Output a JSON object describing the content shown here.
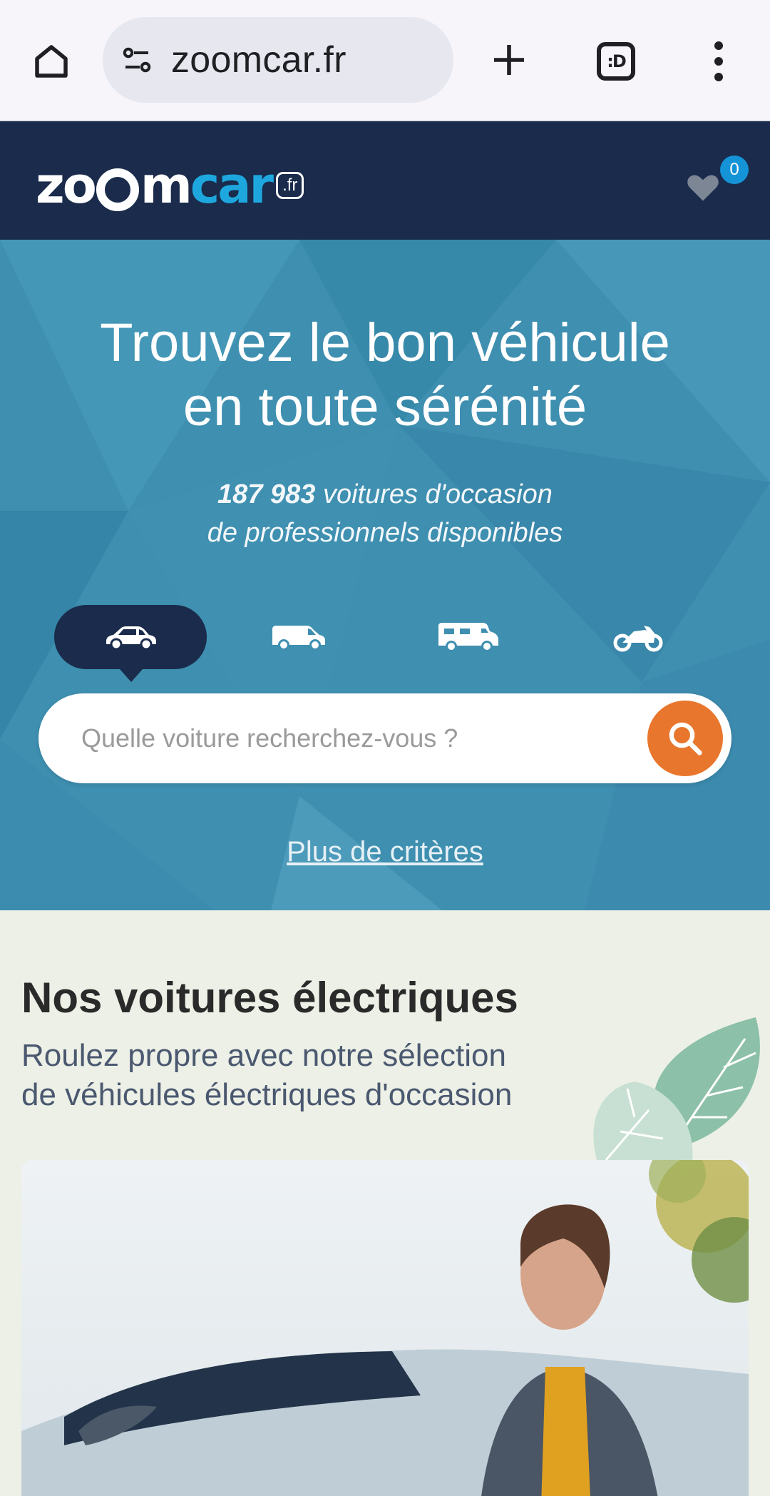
{
  "browser": {
    "url": "zoomcar.fr",
    "tab_icon_text": ":D"
  },
  "header": {
    "logo_text_zo": "zo",
    "logo_text_m": "m",
    "logo_text_car": "car",
    "logo_tld": ".fr",
    "favorites_count": "0"
  },
  "hero": {
    "title_line1": "Trouvez le bon véhicule",
    "title_line2": "en toute sérénité",
    "count": "187 983",
    "sub_line1_rest": " voitures d'occasion",
    "sub_line2": "de professionnels disponibles",
    "vehicle_tabs": [
      {
        "icon": "car-icon",
        "active": true
      },
      {
        "icon": "van-icon",
        "active": false
      },
      {
        "icon": "motorhome-icon",
        "active": false
      },
      {
        "icon": "motorcycle-icon",
        "active": false
      }
    ],
    "search_placeholder": "Quelle voiture recherchez-vous ?",
    "more_criteria": "Plus de critères"
  },
  "electric": {
    "title": "Nos voitures électriques",
    "sub_line1": "Roulez propre avec notre sélection",
    "sub_line2": "de véhicules électriques d'occasion"
  },
  "colors": {
    "header_bg": "#1a2b4b",
    "hero_bg": "#3e8fb0",
    "accent_orange": "#e8762c",
    "logo_blue": "#1ea7df",
    "badge_blue": "#1593d7",
    "section_bg": "#edf0e6"
  }
}
